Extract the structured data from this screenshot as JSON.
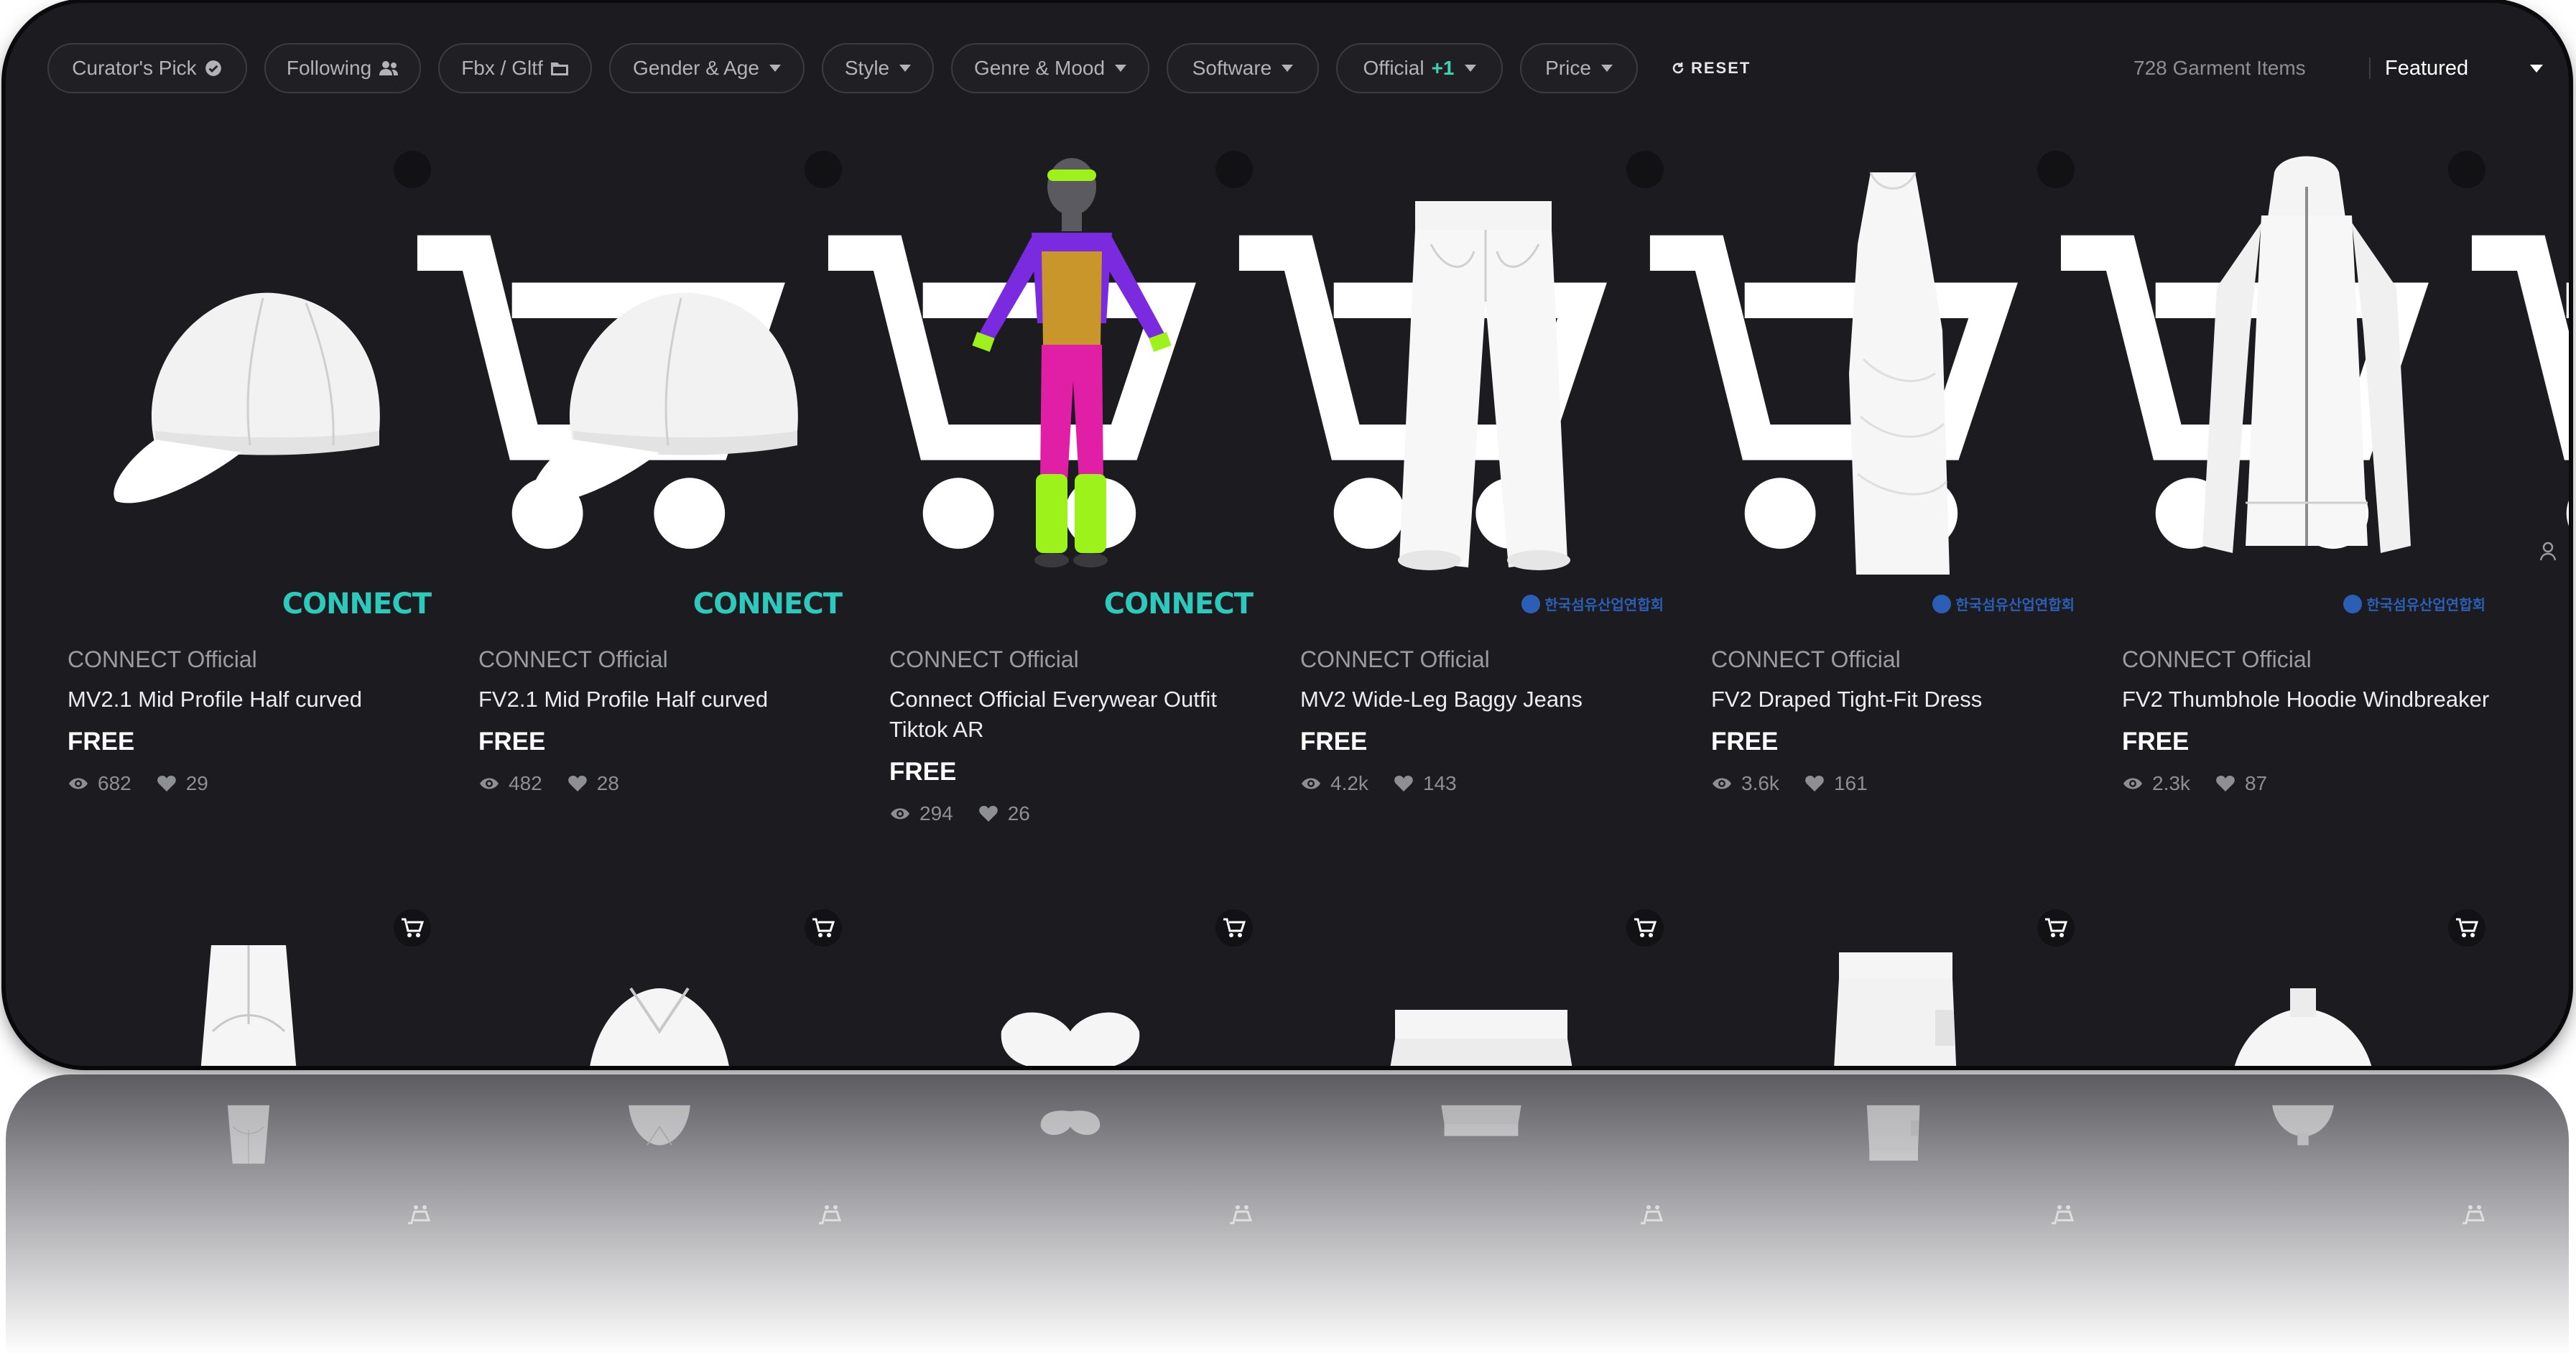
{
  "filters": [
    {
      "label": "Curator's Pick",
      "icon": "check-badge-icon"
    },
    {
      "label": "Following",
      "icon": "users-icon"
    },
    {
      "label": "Fbx / Gltf",
      "icon": "folder-icon"
    },
    {
      "label": "Gender & Age",
      "icon": "chevron-down-icon"
    },
    {
      "label": "Style",
      "icon": "chevron-down-icon"
    },
    {
      "label": "Genre & Mood",
      "icon": "chevron-down-icon"
    },
    {
      "label": "Software",
      "icon": "chevron-down-icon"
    },
    {
      "label": "Official",
      "badge": "+1",
      "icon": "chevron-down-icon"
    },
    {
      "label": "Price",
      "icon": "chevron-down-icon"
    }
  ],
  "reset_label": "RESET",
  "item_count": "728 Garment Items",
  "sort": {
    "selected": "Featured"
  },
  "products": [
    {
      "seller": "CONNECT Official",
      "title": "MV2.1 Mid Profile Half curved",
      "price": "FREE",
      "views": "682",
      "likes": "29",
      "brand_mark": "CONNECT"
    },
    {
      "seller": "CONNECT Official",
      "title": "FV2.1 Mid Profile Half curved",
      "price": "FREE",
      "views": "482",
      "likes": "28",
      "brand_mark": "CONNECT"
    },
    {
      "seller": "CONNECT Official",
      "title": "Connect Official Everywear Outfit Tiktok AR",
      "price": "FREE",
      "views": "294",
      "likes": "26",
      "brand_mark": "CONNECT"
    },
    {
      "seller": "CONNECT Official",
      "title": "MV2 Wide-Leg Baggy Jeans",
      "price": "FREE",
      "views": "4.2k",
      "likes": "143",
      "brand_mark": "한국섬유산업연합회"
    },
    {
      "seller": "CONNECT Official",
      "title": "FV2 Draped Tight-Fit Dress",
      "price": "FREE",
      "views": "3.6k",
      "likes": "161",
      "brand_mark": "한국섬유산업연합회"
    },
    {
      "seller": "CONNECT Official",
      "title": "FV2 Thumbhole Hoodie Windbreaker",
      "price": "FREE",
      "views": "2.3k",
      "likes": "87",
      "brand_mark": "한국섬유산업연합회"
    }
  ],
  "colors": {
    "background": "#1c1c20",
    "accent_teal": "#2ec9bd",
    "neon_purple": "#7a2be0",
    "neon_pink": "#e01ea6",
    "neon_green": "#9cf21a",
    "korean_brand_blue": "#2b5fb5"
  }
}
